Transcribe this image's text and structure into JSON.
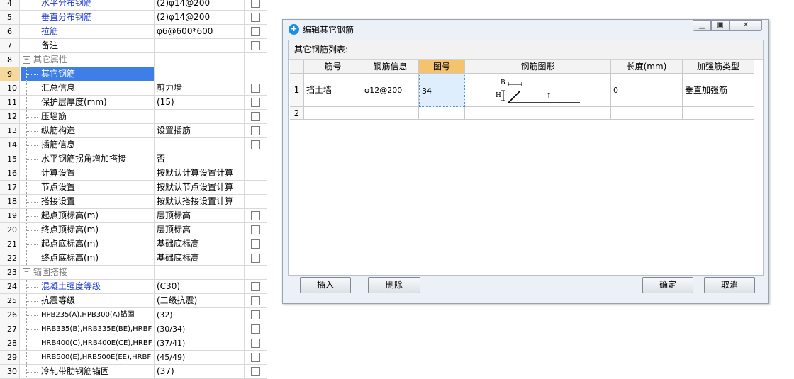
{
  "property_grid": {
    "rows": [
      {
        "num": "4",
        "name": "水平分布钢筋",
        "value": "(2)φ14@200",
        "kind": "child",
        "blue": true,
        "checkbox": true
      },
      {
        "num": "5",
        "name": "垂直分布钢筋",
        "value": "(2)φ14@200",
        "kind": "child",
        "blue": true,
        "checkbox": true
      },
      {
        "num": "6",
        "name": "拉筋",
        "value": "φ6@600*600",
        "kind": "child",
        "blue": true,
        "checkbox": true
      },
      {
        "num": "7",
        "name": "备注",
        "value": "",
        "kind": "child",
        "blue": false,
        "checkbox": true
      },
      {
        "num": "8",
        "name": "其它属性",
        "value": "",
        "kind": "group",
        "blue": false,
        "checkbox": false
      },
      {
        "num": "9",
        "name": "其它钢筋",
        "value": "",
        "kind": "tree",
        "blue": false,
        "checkbox": false,
        "selected": true
      },
      {
        "num": "10",
        "name": "汇总信息",
        "value": "剪力墙",
        "kind": "tree",
        "blue": false,
        "checkbox": true
      },
      {
        "num": "11",
        "name": "保护层厚度(mm)",
        "value": "(15)",
        "kind": "tree",
        "blue": false,
        "checkbox": true
      },
      {
        "num": "12",
        "name": "压墙筋",
        "value": "",
        "kind": "tree",
        "blue": false,
        "checkbox": true
      },
      {
        "num": "13",
        "name": "纵筋构造",
        "value": "设置插筋",
        "kind": "tree",
        "blue": false,
        "checkbox": true
      },
      {
        "num": "14",
        "name": "插筋信息",
        "value": "",
        "kind": "tree",
        "blue": false,
        "checkbox": true
      },
      {
        "num": "15",
        "name": "水平钢筋拐角增加搭接",
        "value": "否",
        "kind": "tree",
        "blue": false,
        "checkbox": false
      },
      {
        "num": "16",
        "name": "计算设置",
        "value": "按默认计算设置计算",
        "kind": "tree",
        "blue": false,
        "checkbox": false
      },
      {
        "num": "17",
        "name": "节点设置",
        "value": "按默认节点设置计算",
        "kind": "tree",
        "blue": false,
        "checkbox": false
      },
      {
        "num": "18",
        "name": "搭接设置",
        "value": "按默认搭接设置计算",
        "kind": "tree",
        "blue": false,
        "checkbox": false
      },
      {
        "num": "19",
        "name": "起点顶标高(m)",
        "value": "层顶标高",
        "kind": "tree",
        "blue": false,
        "checkbox": true
      },
      {
        "num": "20",
        "name": "终点顶标高(m)",
        "value": "层顶标高",
        "kind": "tree",
        "blue": false,
        "checkbox": true
      },
      {
        "num": "21",
        "name": "起点底标高(m)",
        "value": "基础底标高",
        "kind": "tree",
        "blue": false,
        "checkbox": true
      },
      {
        "num": "22",
        "name": "终点底标高(m)",
        "value": "基础底标高",
        "kind": "tree",
        "blue": false,
        "checkbox": true
      },
      {
        "num": "23",
        "name": "锚固搭接",
        "value": "",
        "kind": "group",
        "blue": false,
        "checkbox": false
      },
      {
        "num": "24",
        "name": "混凝土强度等级",
        "value": "(C30)",
        "kind": "tree",
        "blue": true,
        "checkbox": true
      },
      {
        "num": "25",
        "name": "抗震等级",
        "value": "(三级抗震)",
        "kind": "tree",
        "blue": false,
        "checkbox": true
      },
      {
        "num": "26",
        "name": "HPB235(A),HPB300(A)锚固",
        "value": "(32)",
        "kind": "tree",
        "blue": false,
        "checkbox": true,
        "small": true
      },
      {
        "num": "27",
        "name": "HRB335(B),HRB335E(BE),HRBF",
        "value": "(30/34)",
        "kind": "tree",
        "blue": false,
        "checkbox": true,
        "small": true
      },
      {
        "num": "28",
        "name": "HRB400(C),HRB400E(CE),HRBF",
        "value": "(37/41)",
        "kind": "tree",
        "blue": false,
        "checkbox": true,
        "small": true
      },
      {
        "num": "29",
        "name": "HRB500(E),HRB500E(EE),HRBF",
        "value": "(45/49)",
        "kind": "tree",
        "blue": false,
        "checkbox": true,
        "small": true
      },
      {
        "num": "30",
        "name": "冷轧带肋钢筋锚固",
        "value": "(37)",
        "kind": "tree",
        "blue": false,
        "checkbox": true
      }
    ]
  },
  "dialog": {
    "title": "编辑其它钢筋",
    "min_icon": "minimize-icon",
    "max_icon": "maximize-icon",
    "close_icon": "close-icon",
    "list_label": "其它钢筋列表:",
    "columns": [
      "筋号",
      "钢筋信息",
      "图号",
      "钢筋图形",
      "长度(mm)",
      "加强筋类型"
    ],
    "rows": [
      {
        "num": "1",
        "bar_name": "挡土墙",
        "bar_info": "φ12@200",
        "shape_no": "34",
        "shape": {
          "b": "B",
          "h": "H",
          "l": "L"
        },
        "length": "0",
        "type": "垂直加强筋"
      },
      {
        "num": "2",
        "bar_name": "",
        "bar_info": "",
        "shape_no": "",
        "shape": null,
        "length": "",
        "type": ""
      }
    ],
    "buttons": {
      "insert": "插入",
      "delete": "删除",
      "ok": "确定",
      "cancel": "取消"
    }
  }
}
